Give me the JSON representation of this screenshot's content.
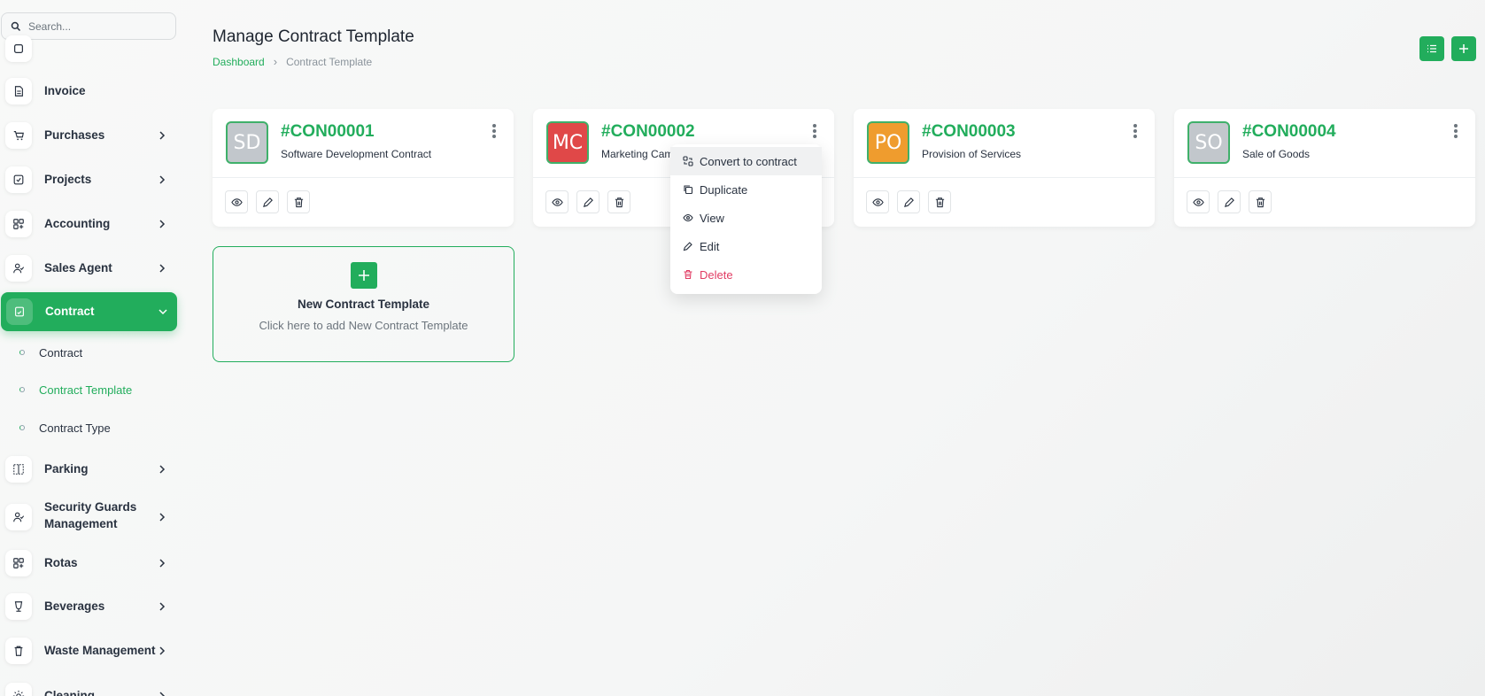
{
  "search": {
    "placeholder": "Search..."
  },
  "sidebar": {
    "items": [
      {
        "label": "Invoice",
        "icon": "file-invoice-icon"
      },
      {
        "label": "Purchases",
        "icon": "cart-icon"
      },
      {
        "label": "Projects",
        "icon": "checkbox-icon"
      },
      {
        "label": "Accounting",
        "icon": "grid-plus-icon"
      },
      {
        "label": "Sales Agent",
        "icon": "user-check-icon"
      },
      {
        "label": "Contract",
        "icon": "contract-icon",
        "active": true
      },
      {
        "label": "Parking",
        "icon": "parking-icon"
      },
      {
        "label": "Security Guards",
        "label2": "Management",
        "icon": "user-check-icon"
      },
      {
        "label": "Rotas",
        "icon": "grid-plus-icon"
      },
      {
        "label": "Beverages",
        "icon": "cup-icon"
      },
      {
        "label": "Waste Management",
        "icon": "trash-icon"
      },
      {
        "label": "Cleaning",
        "icon": "sun-icon"
      }
    ],
    "submenu": [
      {
        "label": "Contract"
      },
      {
        "label": "Contract Template",
        "active": true
      },
      {
        "label": "Contract Type"
      }
    ]
  },
  "header": {
    "title": "Manage Contract Template",
    "breadcrumb": {
      "home": "Dashboard",
      "sep": "›",
      "current": "Contract Template"
    }
  },
  "cards": [
    {
      "initials": "SD",
      "code": "#CON00001",
      "name": "Software Development Contract",
      "color": "#c2c7cc"
    },
    {
      "initials": "MC",
      "code": "#CON00002",
      "name": "Marketing Campaign Contract",
      "color": "#e04848"
    },
    {
      "initials": "PO",
      "code": "#CON00003",
      "name": "Provision of Services",
      "color": "#ef9c2e"
    },
    {
      "initials": "SO",
      "code": "#CON00004",
      "name": "Sale of Goods",
      "color": "#c2c7cc"
    }
  ],
  "new_card": {
    "plus": "+",
    "title": "New Contract Template",
    "subtitle": "Click here to add New Contract Template"
  },
  "dropdown": {
    "items": [
      {
        "label": "Convert to contract",
        "icon": "convert-icon"
      },
      {
        "label": "Duplicate",
        "icon": "copy-icon"
      },
      {
        "label": "View",
        "icon": "eye-icon"
      },
      {
        "label": "Edit",
        "icon": "pencil-icon"
      },
      {
        "label": "Delete",
        "icon": "trash-icon"
      }
    ]
  },
  "colors": {
    "accent": "#22ad5c",
    "danger": "#e13c63"
  }
}
